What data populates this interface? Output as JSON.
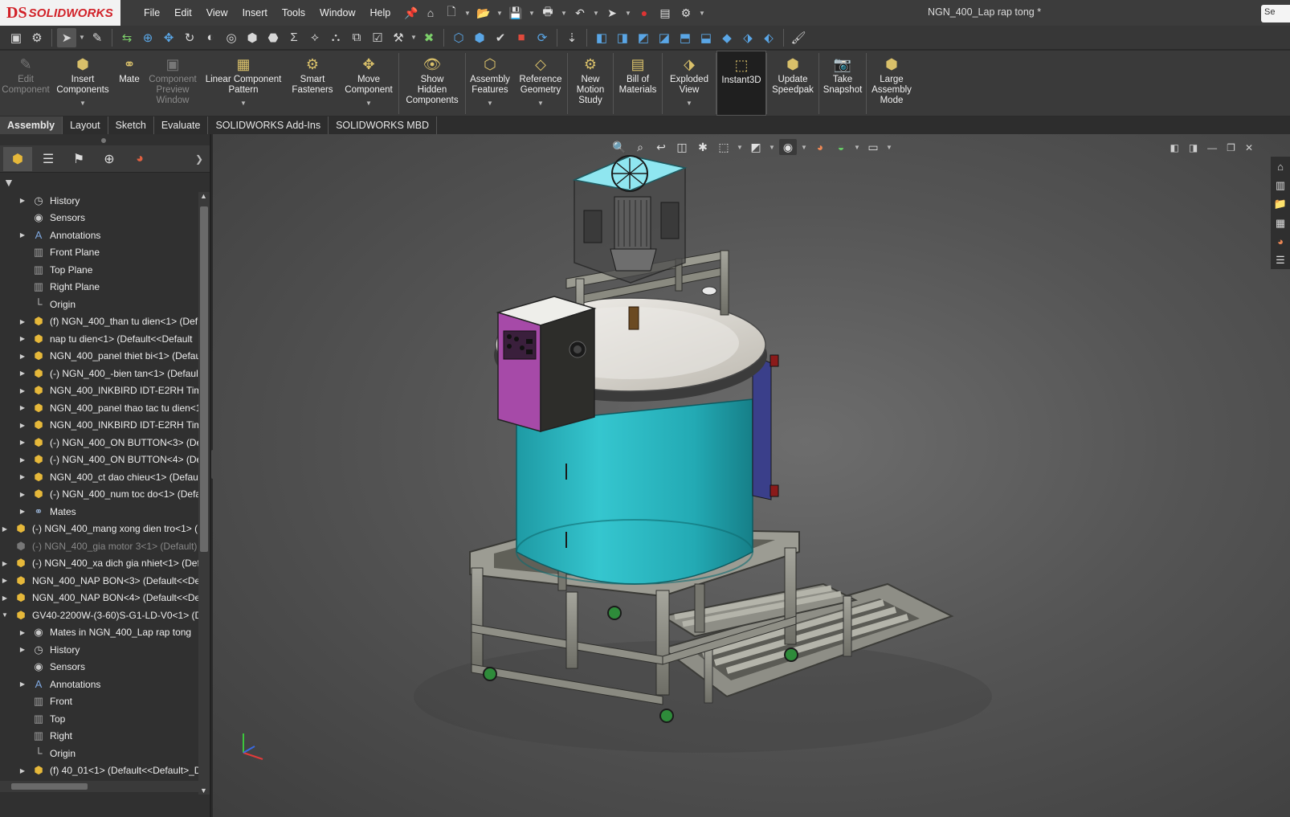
{
  "app": {
    "logo_prefix": "DS",
    "logo_name": "SOLIDWORKS",
    "document_title": "NGN_400_Lap rap tong *",
    "search_placeholder": "Se"
  },
  "menu": {
    "items": [
      "File",
      "Edit",
      "View",
      "Insert",
      "Tools",
      "Window",
      "Help"
    ]
  },
  "ribbon": {
    "buttons": [
      {
        "label": "Edit\nComponent",
        "icon": "edit-component-icon",
        "enabled": false
      },
      {
        "label": "Insert\nComponents",
        "icon": "insert-components-icon",
        "enabled": true,
        "dropdown": true
      },
      {
        "label": "Mate",
        "icon": "mate-icon",
        "enabled": true
      },
      {
        "label": "Component\nPreview\nWindow",
        "icon": "component-preview-icon",
        "enabled": false
      },
      {
        "label": "Linear Component\nPattern",
        "icon": "linear-pattern-icon",
        "enabled": true,
        "dropdown": true
      },
      {
        "label": "Smart\nFasteners",
        "icon": "smart-fasteners-icon",
        "enabled": true
      },
      {
        "label": "Move\nComponent",
        "icon": "move-component-icon",
        "enabled": true,
        "dropdown": true
      },
      {
        "label": "Show\nHidden\nComponents",
        "icon": "show-hidden-icon",
        "enabled": true
      },
      {
        "label": "Assembly\nFeatures",
        "icon": "assembly-features-icon",
        "enabled": true,
        "dropdown": true
      },
      {
        "label": "Reference\nGeometry",
        "icon": "reference-geometry-icon",
        "enabled": true,
        "dropdown": true
      },
      {
        "label": "New\nMotion\nStudy",
        "icon": "motion-study-icon",
        "enabled": true
      },
      {
        "label": "Bill of\nMaterials",
        "icon": "bom-icon",
        "enabled": true
      },
      {
        "label": "Exploded\nView",
        "icon": "exploded-view-icon",
        "enabled": true,
        "dropdown": true
      },
      {
        "label": "Instant3D",
        "icon": "instant3d-icon",
        "enabled": true,
        "active": true
      },
      {
        "label": "Update\nSpeedpak",
        "icon": "speedpak-icon",
        "enabled": true
      },
      {
        "label": "Take\nSnapshot",
        "icon": "snapshot-icon",
        "enabled": true
      },
      {
        "label": "Large\nAssembly\nMode",
        "icon": "large-assembly-icon",
        "enabled": true
      }
    ]
  },
  "tabs": [
    {
      "label": "Assembly",
      "active": true
    },
    {
      "label": "Layout",
      "active": false
    },
    {
      "label": "Sketch",
      "active": false
    },
    {
      "label": "Evaluate",
      "active": false
    },
    {
      "label": "SOLIDWORKS Add-Ins",
      "active": false
    },
    {
      "label": "SOLIDWORKS MBD",
      "active": false
    }
  ],
  "tree": [
    {
      "label": "History",
      "icon": "history",
      "level": 1,
      "expander": true
    },
    {
      "label": "Sensors",
      "icon": "sensor",
      "level": 1,
      "expander": false
    },
    {
      "label": "Annotations",
      "icon": "anno",
      "level": 1,
      "expander": true
    },
    {
      "label": "Front Plane",
      "icon": "plane",
      "level": 1,
      "expander": false
    },
    {
      "label": "Top Plane",
      "icon": "plane",
      "level": 1,
      "expander": false
    },
    {
      "label": "Right Plane",
      "icon": "plane",
      "level": 1,
      "expander": false
    },
    {
      "label": "Origin",
      "icon": "origin",
      "level": 1,
      "expander": false
    },
    {
      "label": "(f) NGN_400_than tu dien<1> (Def",
      "icon": "part",
      "level": 1,
      "expander": true
    },
    {
      "label": "nap tu dien<1> (Default<<Default",
      "icon": "part",
      "level": 1,
      "expander": true
    },
    {
      "label": "NGN_400_panel thiet bi<1> (Defau",
      "icon": "part",
      "level": 1,
      "expander": true
    },
    {
      "label": "(-) NGN_400_-bien tan<1> (Defaul",
      "icon": "part",
      "level": 1,
      "expander": true
    },
    {
      "label": "NGN_400_INKBIRD IDT-E2RH Time",
      "icon": "part",
      "level": 1,
      "expander": true
    },
    {
      "label": "NGN_400_panel thao tac tu dien<1",
      "icon": "part",
      "level": 1,
      "expander": true
    },
    {
      "label": "NGN_400_INKBIRD IDT-E2RH Time",
      "icon": "part",
      "level": 1,
      "expander": true
    },
    {
      "label": "(-) NGN_400_ON BUTTON<3> (Def",
      "icon": "part",
      "level": 1,
      "expander": true
    },
    {
      "label": "(-) NGN_400_ON BUTTON<4> (Def",
      "icon": "part",
      "level": 1,
      "expander": true
    },
    {
      "label": "NGN_400_ct dao chieu<1> (Defaul",
      "icon": "part",
      "level": 1,
      "expander": true
    },
    {
      "label": "(-) NGN_400_num toc do<1> (Defa",
      "icon": "part",
      "level": 1,
      "expander": true
    },
    {
      "label": "Mates",
      "icon": "mates",
      "level": 1,
      "expander": true
    },
    {
      "label": "(-) NGN_400_mang xong dien tro<1> (",
      "icon": "part",
      "level": 0,
      "expander": true
    },
    {
      "label": "(-) NGN_400_gia motor 3<1> (Default)",
      "icon": "part",
      "level": 0,
      "expander": false,
      "suppressed": true
    },
    {
      "label": "(-) NGN_400_xa dich gia nhiet<1> (Def",
      "icon": "part",
      "level": 0,
      "expander": true
    },
    {
      "label": "NGN_400_NAP BON<3> (Default<<De",
      "icon": "part",
      "level": 0,
      "expander": true
    },
    {
      "label": "NGN_400_NAP BON<4> (Default<<De",
      "icon": "part",
      "level": 0,
      "expander": true
    },
    {
      "label": "GV40-2200W-(3-60)S-G1-LD-V0<1> (D",
      "icon": "part",
      "level": 0,
      "expander": true,
      "expanded": true
    },
    {
      "label": "Mates in NGN_400_Lap rap tong",
      "icon": "sensor",
      "level": 1,
      "expander": true
    },
    {
      "label": "History",
      "icon": "history",
      "level": 1,
      "expander": true
    },
    {
      "label": "Sensors",
      "icon": "sensor",
      "level": 1,
      "expander": false
    },
    {
      "label": "Annotations",
      "icon": "anno",
      "level": 1,
      "expander": true
    },
    {
      "label": "Front",
      "icon": "plane",
      "level": 1,
      "expander": false
    },
    {
      "label": "Top",
      "icon": "plane",
      "level": 1,
      "expander": false
    },
    {
      "label": "Right",
      "icon": "plane",
      "level": 1,
      "expander": false
    },
    {
      "label": "Origin",
      "icon": "origin",
      "level": 1,
      "expander": false
    },
    {
      "label": "(f) 40_01<1> (Default<<Default>_D",
      "icon": "part",
      "level": 1,
      "expander": true
    }
  ],
  "colors": {
    "tank": "#29b7c0",
    "panel": "#a64aa8",
    "frame": "#8a8a82",
    "motor_fan": "#8fe6f0",
    "casters": "#2e8b3a"
  }
}
